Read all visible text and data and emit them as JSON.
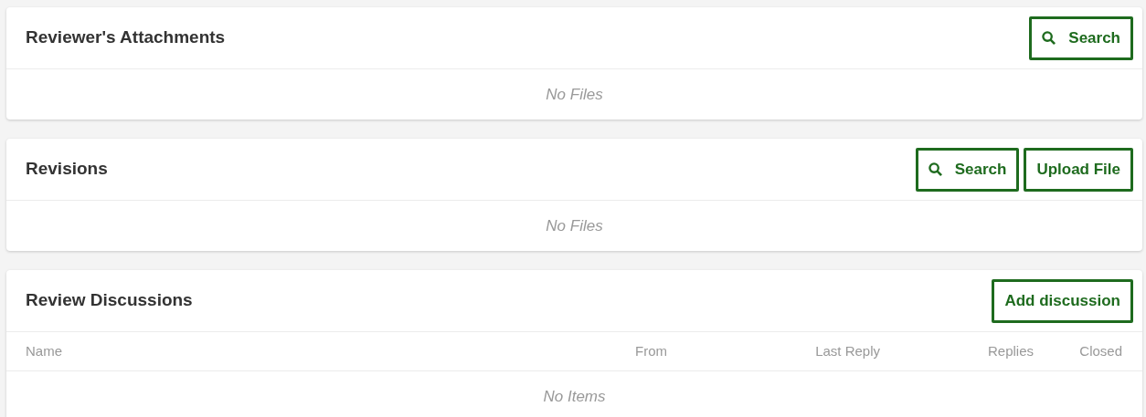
{
  "panels": [
    {
      "title": "Reviewer's Attachments",
      "buttons": [
        {
          "kind": "search",
          "label": "Search"
        }
      ],
      "empty_text": "No Files"
    },
    {
      "title": "Revisions",
      "buttons": [
        {
          "kind": "search",
          "label": "Search"
        },
        {
          "kind": "plain",
          "label": "Upload File"
        }
      ],
      "empty_text": "No Files"
    },
    {
      "title": "Review Discussions",
      "buttons": [
        {
          "kind": "plain",
          "label": "Add discussion"
        }
      ],
      "columns": [
        "Name",
        "From",
        "Last Reply",
        "Replies",
        "Closed"
      ],
      "empty_text": "No Items"
    }
  ]
}
